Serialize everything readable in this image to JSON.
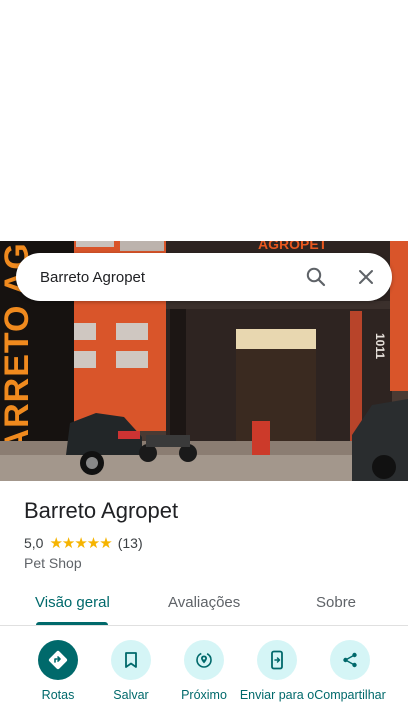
{
  "search": {
    "query": "Barreto Agropet"
  },
  "hero": {
    "sign_vertical": "BARRETO AGROPE",
    "sign_top": "AGROPET",
    "street_number": "1011"
  },
  "place": {
    "title": "Barreto Agropet",
    "rating": "5,0",
    "stars": "★★★★★",
    "review_count": "(13)",
    "category": "Pet Shop"
  },
  "tabs": [
    {
      "label": "Visão geral"
    },
    {
      "label": "Avaliações"
    },
    {
      "label": "Sobre"
    }
  ],
  "actions": [
    {
      "label": "Rotas",
      "icon": "directions-icon"
    },
    {
      "label": "Salvar",
      "icon": "bookmark-icon"
    },
    {
      "label": "Próximo",
      "icon": "nearby-icon"
    },
    {
      "label": "Enviar para o",
      "icon": "send-to-phone-icon"
    },
    {
      "label": "Compartilhar",
      "icon": "share-icon"
    }
  ],
  "colors": {
    "accent": "#00696b",
    "chip": "#d5f5f6",
    "star": "#f6b400",
    "sign_orange": "#e8581f"
  }
}
